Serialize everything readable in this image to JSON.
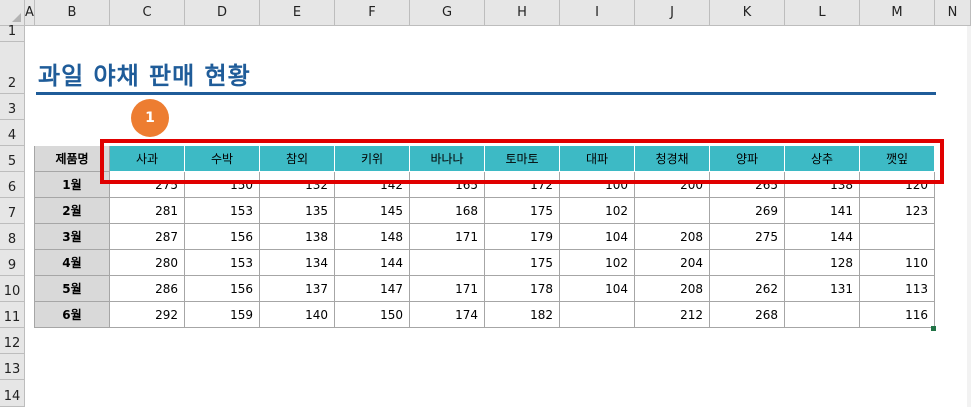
{
  "columns": [
    "A",
    "B",
    "C",
    "D",
    "E",
    "F",
    "G",
    "H",
    "I",
    "J",
    "K",
    "L",
    "M",
    "N"
  ],
  "rows": [
    "1",
    "2",
    "3",
    "4",
    "5",
    "6",
    "7",
    "8",
    "9",
    "10",
    "11",
    "12",
    "13",
    "14"
  ],
  "title": "과일 야채 판매 현황",
  "callout": "1",
  "table": {
    "corner_label": "제품명",
    "products": [
      "사과",
      "수박",
      "참외",
      "키위",
      "바나나",
      "토마토",
      "대파",
      "청경채",
      "양파",
      "상추",
      "깻잎"
    ],
    "months": [
      "1월",
      "2월",
      "3월",
      "4월",
      "5월",
      "6월"
    ],
    "values": [
      [
        "275",
        "150",
        "132",
        "142",
        "165",
        "172",
        "100",
        "200",
        "265",
        "138",
        "120"
      ],
      [
        "281",
        "153",
        "135",
        "145",
        "168",
        "175",
        "102",
        "",
        "269",
        "141",
        "123"
      ],
      [
        "287",
        "156",
        "138",
        "148",
        "171",
        "179",
        "104",
        "208",
        "275",
        "144",
        ""
      ],
      [
        "280",
        "153",
        "134",
        "144",
        "",
        "175",
        "102",
        "204",
        "",
        "128",
        "110"
      ],
      [
        "286",
        "156",
        "137",
        "147",
        "171",
        "178",
        "104",
        "208",
        "262",
        "131",
        "113"
      ],
      [
        "292",
        "159",
        "140",
        "150",
        "174",
        "182",
        "",
        "212",
        "268",
        "",
        "116"
      ]
    ]
  },
  "colors": {
    "header_fill": "#3dbac5",
    "label_fill": "#d9d9d9",
    "title_color": "#1f5c99",
    "highlight_border": "#e00000",
    "badge_fill": "#ed7d31"
  }
}
